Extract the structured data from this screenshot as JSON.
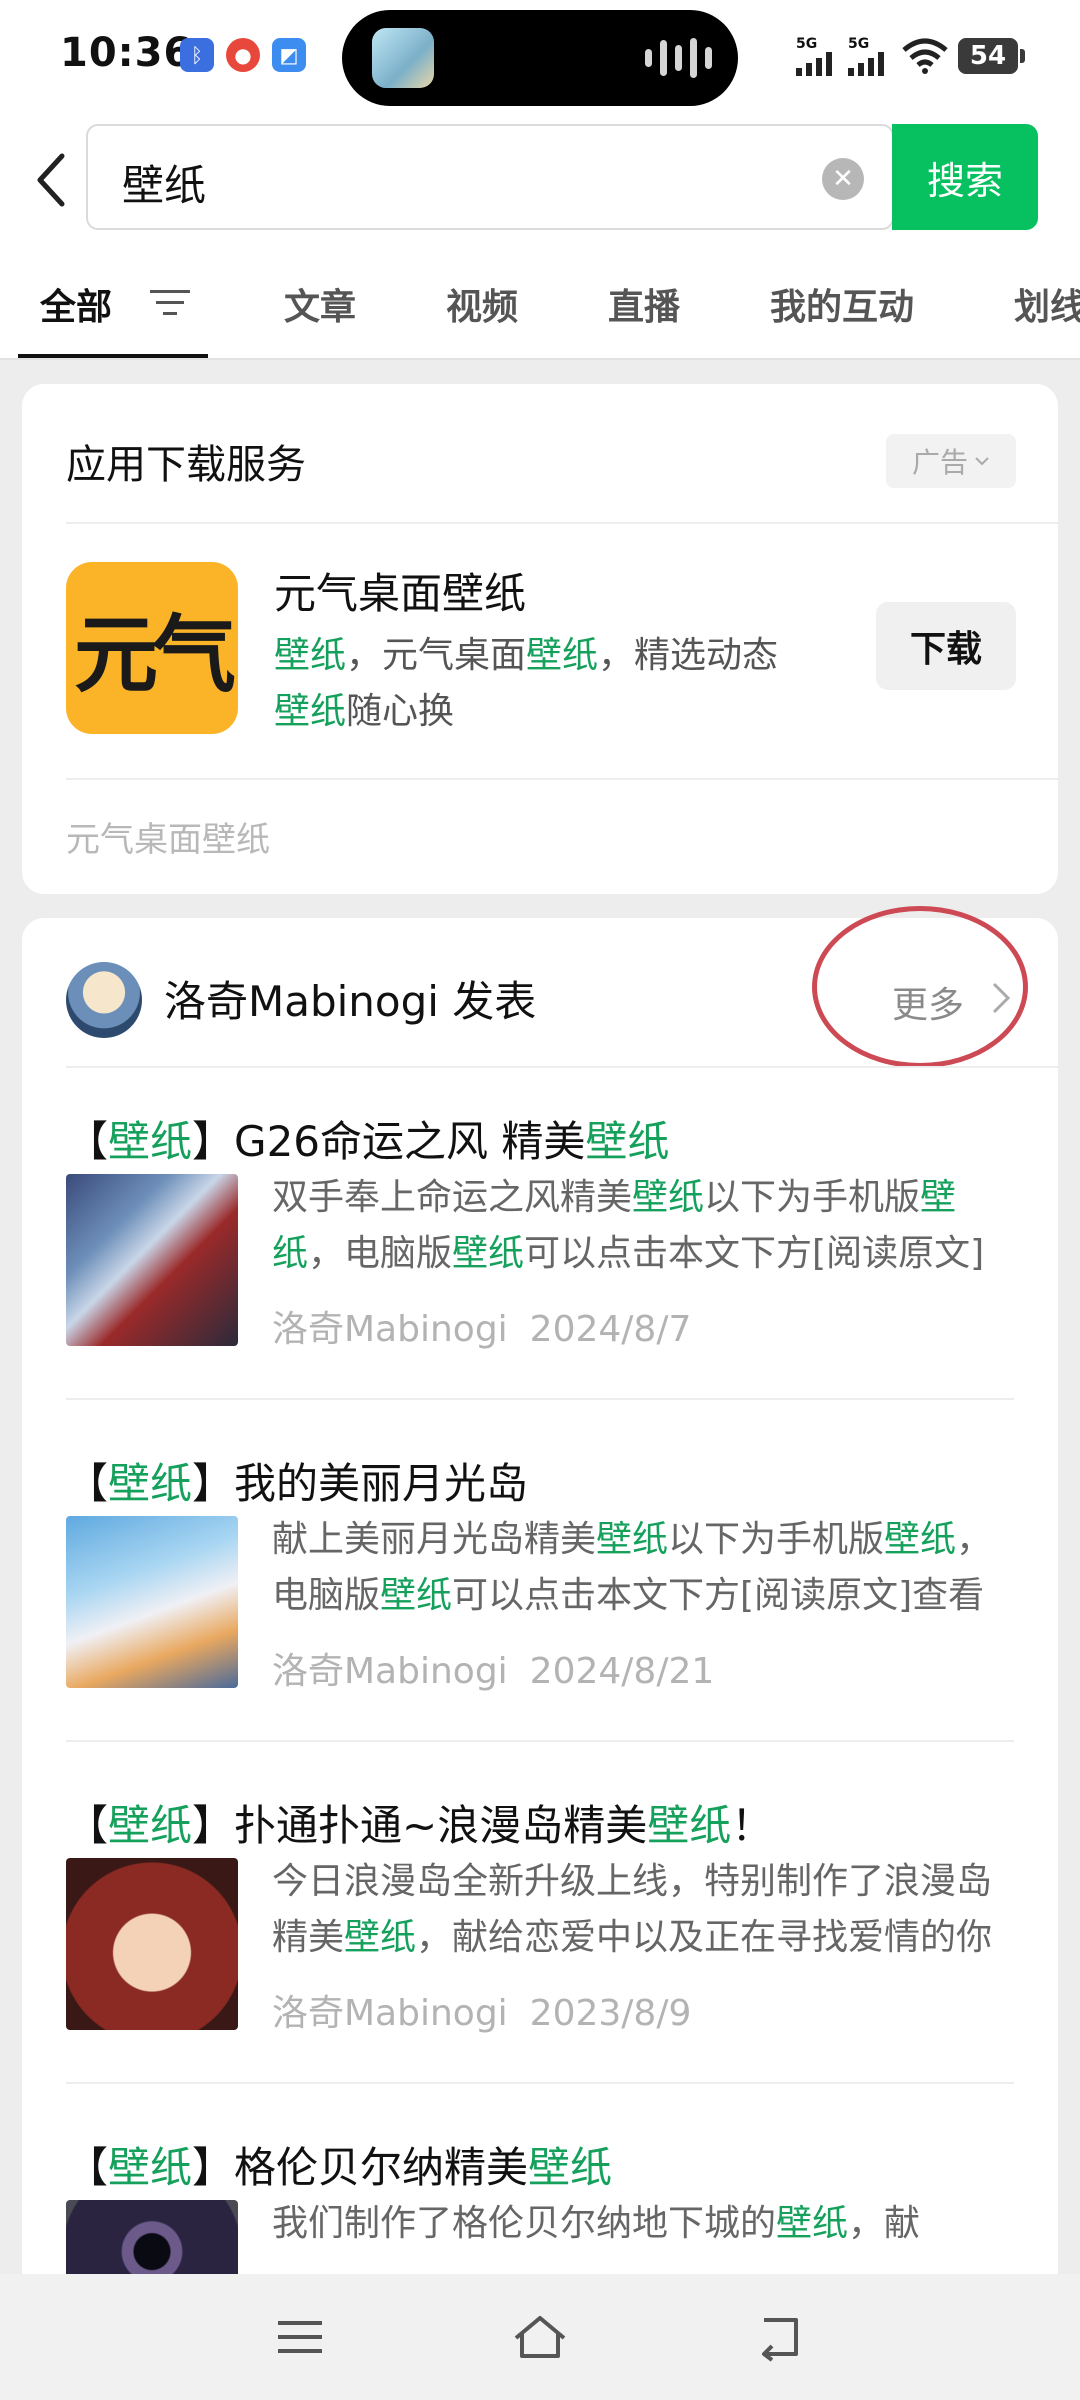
{
  "status_bar": {
    "time": "10:36",
    "network_1": "5G",
    "network_2": "5G",
    "battery": "54",
    "icons": [
      "bluetooth-icon",
      "app-notification-icon",
      "app-notification-icon",
      "music-island-icon",
      "signal-icon",
      "wifi-icon",
      "battery-icon"
    ]
  },
  "search": {
    "query": "壁纸",
    "button_label": "搜索"
  },
  "tabs": [
    {
      "label": "全部",
      "active": true
    },
    {
      "label": "文章"
    },
    {
      "label": "视频"
    },
    {
      "label": "直播"
    },
    {
      "label": "我的互动"
    },
    {
      "label": "划线"
    }
  ],
  "ad": {
    "section_title": "应用下载服务",
    "tag": "广告",
    "app_icon_text": "元气",
    "app_name": "元气桌面壁纸",
    "desc_parts": [
      "壁纸",
      "，元气桌面",
      "壁纸",
      "，精选动态",
      "壁纸",
      "随心换"
    ],
    "download_label": "下载",
    "footer": "元气桌面壁纸"
  },
  "articles_section": {
    "author": "洛奇Mabinogi 发表",
    "more_label": "更多",
    "articles": [
      {
        "title_parts": [
          "【",
          "壁纸",
          "】G26命运之风 精美",
          "壁纸"
        ],
        "summary_parts": [
          "双手奉上命运之风精美",
          "壁纸",
          "以下为手机版",
          "壁纸",
          "，电脑版",
          "壁纸",
          "可以点击本文下方[阅读原文]查看"
        ],
        "source": "洛奇Mabinogi",
        "date": "2024/8/7"
      },
      {
        "title_parts": [
          "【",
          "壁纸",
          "】我的美丽月光岛"
        ],
        "summary_parts": [
          "献上美丽月光岛精美",
          "壁纸",
          "以下为手机版",
          "壁纸",
          "，电脑版",
          "壁纸",
          "可以点击本文下方[阅读原文]查看"
        ],
        "source": "洛奇Mabinogi",
        "date": "2024/8/21"
      },
      {
        "title_parts": [
          "【",
          "壁纸",
          "】扑通扑通~浪漫岛精美",
          "壁纸",
          "！"
        ],
        "summary_parts": [
          "今日浪漫岛全新升级上线，特别制作了浪漫岛精美",
          "壁纸",
          "，献给恋爱中以及正在寻找爱情的你"
        ],
        "source": "洛奇Mabinogi",
        "date": "2023/8/9"
      },
      {
        "title_parts": [
          "【",
          "壁纸",
          "】格伦贝尔纳精美",
          "壁纸"
        ],
        "summary_parts": [
          "我们制作了格伦贝尔纳地下城的",
          "壁纸",
          "，献"
        ],
        "source": "",
        "date": ""
      }
    ]
  },
  "colors": {
    "accent_green": "#07c160",
    "highlight_green": "#15a05c",
    "annotation_red": "#cd4a55"
  }
}
